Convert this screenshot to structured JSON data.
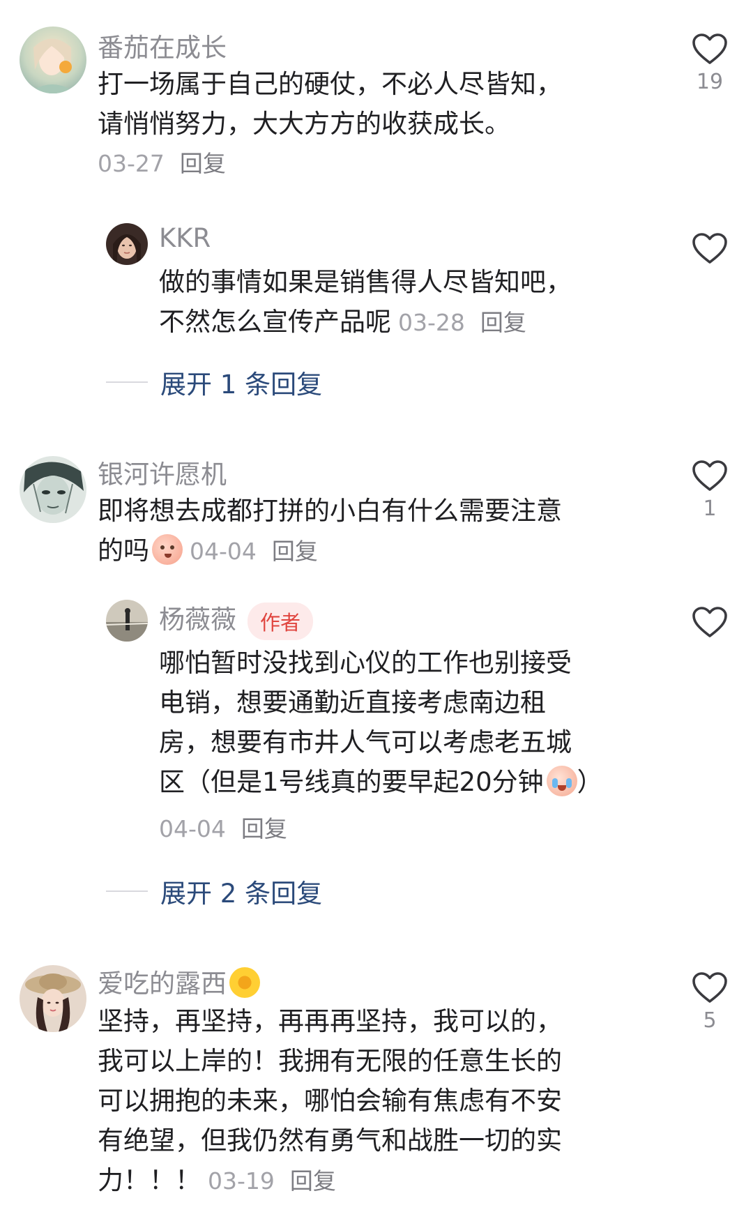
{
  "comments": [
    {
      "username": "番茄在成长",
      "text_lines": [
        "打一场属于自己的硬仗，不必人尽皆知，",
        "请悄悄努力，大大方方的收获成长。"
      ],
      "date": "03-27",
      "reply_label": "回复",
      "likes": "19",
      "avatar_icon": "girl-portrait-avatar"
    },
    {
      "username": "KKR",
      "text_lines": [
        "做的事情如果是销售得人尽皆知吧，",
        "不然怎么宣传产品呢"
      ],
      "date": "03-28",
      "reply_label": "回复",
      "avatar_icon": "woman-selfie-avatar"
    },
    {
      "expand_label": "展开 1 条回复"
    },
    {
      "username": "银河许愿机",
      "text_lines": [
        "即将想去成都打拼的小白有什么需要注意",
        "的吗"
      ],
      "date": "04-04",
      "reply_label": "回复",
      "likes": "1",
      "emoji_icon": "peach-thinking-emoji",
      "avatar_icon": "sketch-face-avatar"
    },
    {
      "username": "杨薇薇",
      "badge": "作者",
      "text_lines": [
        "哪怕暂时没找到心仪的工作也别接受",
        "电销，想要通勤近直接考虑南边租",
        "房，想要有市井人气可以考虑老五城",
        "区（但是1号线真的要早起20分钟",
        "）"
      ],
      "date": "04-04",
      "reply_label": "回复",
      "emoji_icon": "peach-crying-emoji",
      "avatar_icon": "seaside-scene-avatar"
    },
    {
      "expand_label": "展开 2 条回复"
    },
    {
      "username": "爱吃的露西",
      "username_emoji": "sunflower-emoji",
      "text_lines": [
        "坚持，再坚持，再再再坚持，我可以的，",
        "我可以上岸的！我拥有无限的任意生长的",
        "可以拥抱的未来，哪怕会输有焦虑有不安",
        "有绝望，但我仍然有勇气和战胜一切的实",
        "力！！！"
      ],
      "date": "03-19",
      "reply_label": "回复",
      "likes": "5",
      "avatar_icon": "girl-hat-avatar"
    }
  ],
  "colors": {
    "username": "#8c8c92",
    "text": "#1f1f22",
    "meta": "#a2a2a8",
    "expand": "#2b4a7a",
    "author_badge": "#e0453f"
  }
}
